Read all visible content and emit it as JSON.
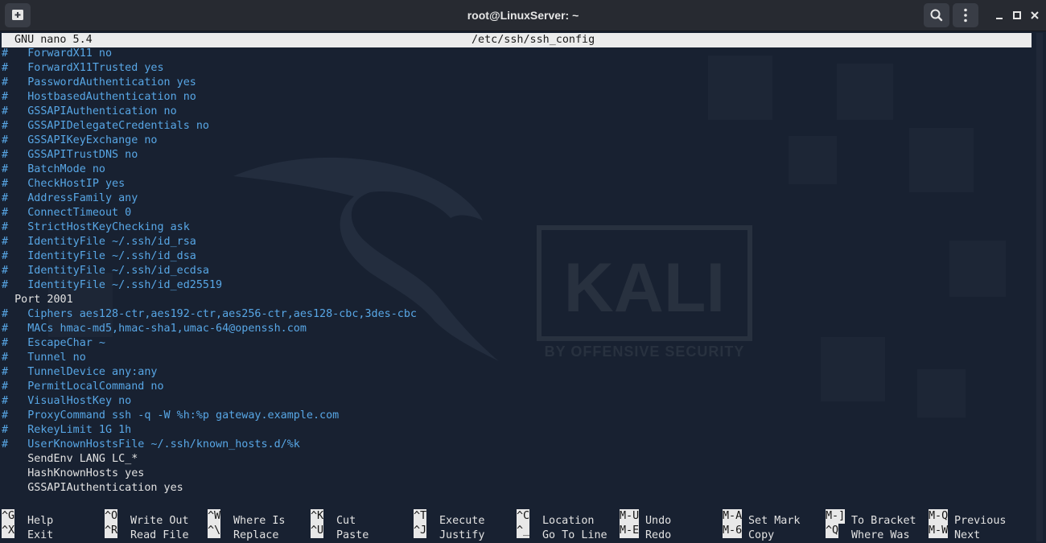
{
  "window": {
    "title": "root@LinuxServer: ~",
    "controls": [
      "minimize-icon",
      "maximize-icon",
      "close-icon"
    ],
    "toolbar_icons": [
      "new-tab-icon",
      "search-icon",
      "menu-icon"
    ]
  },
  "wallpaper": {
    "brand": "KALI",
    "tagline": "BY OFFENSIVE SECURITY"
  },
  "nano": {
    "version": "GNU nano 5.4",
    "filename": "/etc/ssh/ssh_config",
    "lines": [
      {
        "text": "#   ForwardX11 no",
        "comment": true
      },
      {
        "text": "#   ForwardX11Trusted yes",
        "comment": true
      },
      {
        "text": "#   PasswordAuthentication yes",
        "comment": true
      },
      {
        "text": "#   HostbasedAuthentication no",
        "comment": true
      },
      {
        "text": "#   GSSAPIAuthentication no",
        "comment": true
      },
      {
        "text": "#   GSSAPIDelegateCredentials no",
        "comment": true
      },
      {
        "text": "#   GSSAPIKeyExchange no",
        "comment": true
      },
      {
        "text": "#   GSSAPITrustDNS no",
        "comment": true
      },
      {
        "text": "#   BatchMode no",
        "comment": true
      },
      {
        "text": "#   CheckHostIP yes",
        "comment": true
      },
      {
        "text": "#   AddressFamily any",
        "comment": true
      },
      {
        "text": "#   ConnectTimeout 0",
        "comment": true
      },
      {
        "text": "#   StrictHostKeyChecking ask",
        "comment": true
      },
      {
        "text": "#   IdentityFile ~/.ssh/id_rsa",
        "comment": true
      },
      {
        "text": "#   IdentityFile ~/.ssh/id_dsa",
        "comment": true
      },
      {
        "text": "#   IdentityFile ~/.ssh/id_ecdsa",
        "comment": true
      },
      {
        "text": "#   IdentityFile ~/.ssh/id_ed25519",
        "comment": true
      },
      {
        "text": "  Port 2001",
        "comment": false
      },
      {
        "text": "#   Ciphers aes128-ctr,aes192-ctr,aes256-ctr,aes128-cbc,3des-cbc",
        "comment": true
      },
      {
        "text": "#   MACs hmac-md5,hmac-sha1,umac-64@openssh.com",
        "comment": true
      },
      {
        "text": "#   EscapeChar ~",
        "comment": true
      },
      {
        "text": "#   Tunnel no",
        "comment": true
      },
      {
        "text": "#   TunnelDevice any:any",
        "comment": true
      },
      {
        "text": "#   PermitLocalCommand no",
        "comment": true
      },
      {
        "text": "#   VisualHostKey no",
        "comment": true
      },
      {
        "text": "#   ProxyCommand ssh -q -W %h:%p gateway.example.com",
        "comment": true
      },
      {
        "text": "#   RekeyLimit 1G 1h",
        "comment": true
      },
      {
        "text": "#   UserKnownHostsFile ~/.ssh/known_hosts.d/%k",
        "comment": true
      },
      {
        "text": "    SendEnv LANG LC_*",
        "comment": false
      },
      {
        "text": "    HashKnownHosts yes",
        "comment": false
      },
      {
        "text": "    GSSAPIAuthentication yes",
        "comment": false
      }
    ],
    "shortcuts": [
      {
        "key": "^G",
        "label": "Help"
      },
      {
        "key": "^X",
        "label": "Exit"
      },
      {
        "key": "^O",
        "label": "Write Out"
      },
      {
        "key": "^R",
        "label": "Read File"
      },
      {
        "key": "^W",
        "label": "Where Is"
      },
      {
        "key": "^\\",
        "label": "Replace"
      },
      {
        "key": "^K",
        "label": "Cut"
      },
      {
        "key": "^U",
        "label": "Paste"
      },
      {
        "key": "^T",
        "label": "Execute"
      },
      {
        "key": "^J",
        "label": "Justify"
      },
      {
        "key": "^C",
        "label": "Location"
      },
      {
        "key": "^_",
        "label": "Go To Line"
      },
      {
        "key": "M-U",
        "label": "Undo"
      },
      {
        "key": "M-E",
        "label": "Redo"
      },
      {
        "key": "M-A",
        "label": "Set Mark"
      },
      {
        "key": "M-6",
        "label": "Copy"
      },
      {
        "key": "M-]",
        "label": "To Bracket"
      },
      {
        "key": "^Q",
        "label": "Where Was"
      },
      {
        "key": "M-Q",
        "label": "Previous"
      },
      {
        "key": "M-W",
        "label": "Next"
      }
    ]
  },
  "colors": {
    "terminal_bg": "#182131",
    "comment_text": "#58a7e6",
    "plain_text": "#e2e2e2",
    "header_bg": "#ececec",
    "titlebar_bg": "#272a31"
  }
}
